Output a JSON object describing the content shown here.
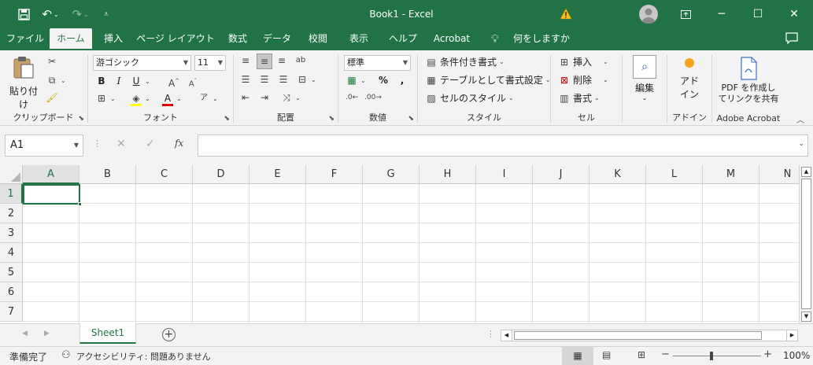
{
  "title_bar": {
    "document_title": "Book1 - Excel",
    "warning_icon": "warning-triangle-icon",
    "account_icon": "user-avatar-icon",
    "window_buttons": [
      "ribbon-display-options",
      "minimize",
      "maximize",
      "close"
    ]
  },
  "quick_access": [
    "save-icon",
    "undo-icon",
    "redo-icon",
    "customize-icon"
  ],
  "tabs": [
    {
      "label": "ファイル"
    },
    {
      "label": "ホーム",
      "active": true
    },
    {
      "label": "挿入"
    },
    {
      "label": "ページ レイアウト"
    },
    {
      "label": "数式"
    },
    {
      "label": "データ"
    },
    {
      "label": "校閲"
    },
    {
      "label": "表示"
    },
    {
      "label": "ヘルプ"
    },
    {
      "label": "Acrobat"
    }
  ],
  "tell_me": "何をしますか",
  "ribbon": {
    "clipboard": {
      "label": "クリップボード",
      "paste": "貼り付け"
    },
    "font": {
      "label": "フォント",
      "font_name": "游ゴシック",
      "font_size": "11"
    },
    "alignment": {
      "label": "配置"
    },
    "number": {
      "label": "数値",
      "format": "標準"
    },
    "styles": {
      "label": "スタイル",
      "conditional": "条件付き書式",
      "table": "テーブルとして書式設定",
      "cell_styles": "セルのスタイル"
    },
    "cells": {
      "label": "セル",
      "insert": "挿入",
      "delete": "削除",
      "format": "書式"
    },
    "editing": {
      "label": "編集"
    },
    "addins": {
      "label": "アドイン",
      "button_line1": "アド",
      "button_line2": "イン"
    },
    "acrobat": {
      "label": "Adobe Acrobat",
      "button_line1": "PDF を作成し",
      "button_line2": "てリンクを共有"
    }
  },
  "formula_bar": {
    "name_box": "A1",
    "fx": "fx",
    "formula": ""
  },
  "grid": {
    "columns": [
      "A",
      "B",
      "C",
      "D",
      "E",
      "F",
      "G",
      "H",
      "I",
      "J",
      "K",
      "L",
      "M",
      "N"
    ],
    "rows": [
      "1",
      "2",
      "3",
      "4",
      "5",
      "6",
      "7"
    ],
    "selected_cell": "A1"
  },
  "sheets": [
    {
      "name": "Sheet1",
      "active": true
    }
  ],
  "status_bar": {
    "ready": "準備完了",
    "accessibility": "アクセシビリティ: 問題ありません",
    "zoom": "100%"
  },
  "colors": {
    "accent": "#217346",
    "ribbon_bg": "#f3f3f3",
    "font_color_bar": "#e00000",
    "highlight_bar": "#ffff00"
  }
}
